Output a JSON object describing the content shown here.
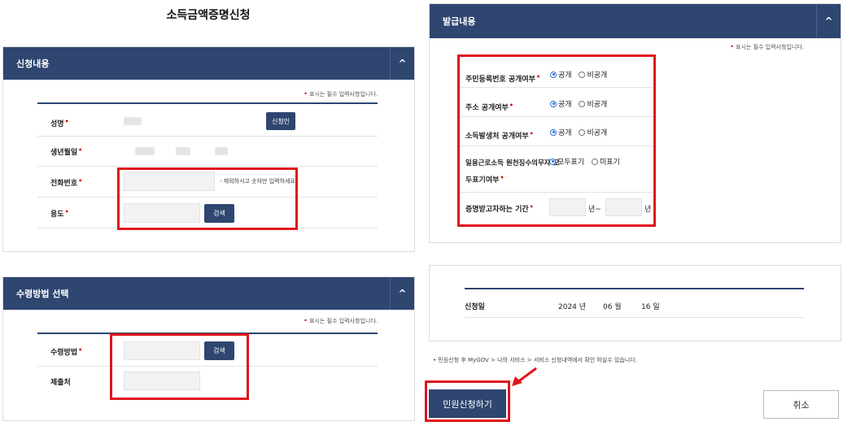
{
  "page_title": "소득금액증명신청",
  "required_note": "표시는 필수 입력사항입니다.",
  "application": {
    "header": "신청내용",
    "name_label": "성명",
    "auth_button": "신청인",
    "birth_label": "생년월일",
    "phone_label": "전화번호",
    "phone_hint": "- 제외하시고 숫자만 입력하세요",
    "purpose_label": "용도",
    "search_button": "검색"
  },
  "receipt": {
    "header": "수령방법 선택",
    "method_label": "수령방법",
    "search_button": "검색",
    "submit_to_label": "제출처"
  },
  "issuance": {
    "header": "발급내용",
    "rows": [
      {
        "label": "주민등록번호 공개여부",
        "opt1": "공개",
        "opt2": "비공개"
      },
      {
        "label": "주소 공개여부",
        "opt1": "공개",
        "opt2": "비공개"
      },
      {
        "label": "소득발생처 공개여부",
        "opt1": "공개",
        "opt2": "비공개"
      }
    ],
    "daily_label_line1": "일용근로소득 원천징수의무자 모",
    "daily_label_line2": "두표기여부",
    "daily_opt1": "모두표기",
    "daily_opt2": "미표기",
    "period_label": "증명받고자하는 기간",
    "year_suffix_1": "년~",
    "year_suffix_2": "년"
  },
  "apply_date": {
    "label": "신청일",
    "year": "2024 년",
    "month": "06 월",
    "day": "16 일"
  },
  "notice": "민원신청 후 MyGOV > 나의 서비스 > 서비스 신청내역에서 확인 하실수 있습니다.",
  "submit_label": "민원신청하기",
  "cancel_label": "취소",
  "chevron": "^"
}
